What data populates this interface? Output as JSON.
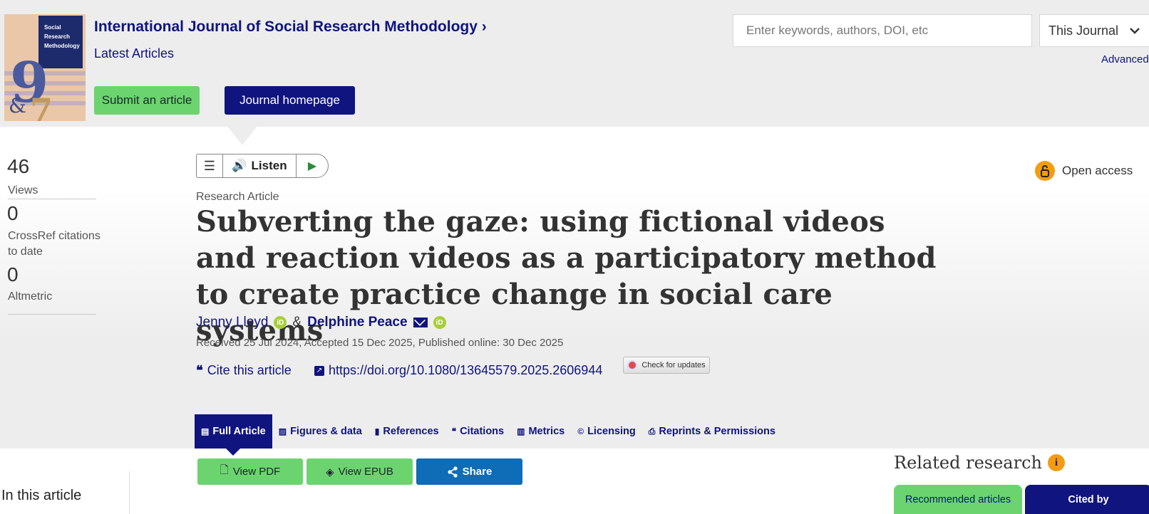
{
  "header": {
    "journal_title": "International Journal of Social Research Methodology",
    "journal_chevron": "›",
    "latest_articles": "Latest Articles",
    "submit_label": "Submit an article",
    "homepage_label": "Journal homepage",
    "cover_lines": [
      "Social",
      "Research",
      "Methodology"
    ],
    "cover_initials": {
      "big": "9",
      "amp": "&",
      "small": "7"
    }
  },
  "search": {
    "placeholder": "Enter keywords, authors, DOI, etc",
    "scope": "This Journal",
    "advanced": "Advanced"
  },
  "metrics": [
    {
      "value": "46",
      "label": "Views"
    },
    {
      "value": "0",
      "label": "CrossRef citations to date"
    },
    {
      "value": "0",
      "label": "Altmetric"
    }
  ],
  "listen": {
    "menu_icon": "☰",
    "speaker_icon": "🔊",
    "label": "Listen",
    "play_icon": "▶"
  },
  "open_access": {
    "label": "Open access",
    "icon": "lock-open-icon"
  },
  "article": {
    "type": "Research Article",
    "title": "Subverting the gaze: using fictional videos and reaction videos as a participatory method to create practice change in social care systems",
    "authors": [
      {
        "name": "Jenny Lloyd"
      },
      {
        "name": "Delphine Peace"
      }
    ],
    "author_separator": "&",
    "orcid_badge": "iD",
    "dates": "Received 25 Jul 2024, Accepted 15 Dec 2025, Published online: 30 Dec 2025",
    "cite_label": "Cite this article",
    "doi": "https://doi.org/10.1080/13645579.2025.2606944",
    "check_updates": "Check for updates"
  },
  "tabs": [
    {
      "label": "Full Article",
      "icon": "▤",
      "active": true
    },
    {
      "label": "Figures & data",
      "icon": "▨"
    },
    {
      "label": "References",
      "icon": "▮"
    },
    {
      "label": "Citations",
      "icon": "❝"
    },
    {
      "label": "Metrics",
      "icon": "▥"
    },
    {
      "label": "Licensing",
      "icon": "©"
    },
    {
      "label": "Reprints & Permissions",
      "icon": "⎙"
    }
  ],
  "actions": {
    "view_pdf": "View PDF",
    "view_epub": "View EPUB",
    "share": "Share",
    "pdf_icon": "🗋",
    "epub_icon": "◈",
    "share_icon": "⋖"
  },
  "in_this_article": "In this article",
  "related": {
    "title": "Related research",
    "info_icon": "i",
    "tab_recommended": "Recommended articles",
    "tab_cited_by": "Cited by"
  },
  "colors": {
    "brand_navy": "#10147e",
    "green": "#6bd46f",
    "share_blue": "#0f6cb6",
    "orange": "#f39c12"
  }
}
